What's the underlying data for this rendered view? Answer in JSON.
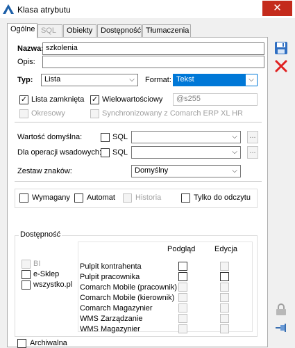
{
  "window": {
    "title": "Klasa atrybutu",
    "close_glyph": "✕"
  },
  "tabs": [
    {
      "label": "Ogólne",
      "state": "active"
    },
    {
      "label": "SQL",
      "state": "disabled"
    },
    {
      "label": "Obiekty",
      "state": "normal"
    },
    {
      "label": "Dostępność",
      "state": "normal"
    },
    {
      "label": "Tłumaczenia",
      "state": "normal"
    }
  ],
  "form": {
    "nazwa_label": "Nazwa:",
    "nazwa_value": "szkolenia",
    "opis_label": "Opis:",
    "opis_value": "",
    "typ_label": "Typ:",
    "typ_value": "Lista",
    "format_label": "Format:",
    "format_value": "Tekst",
    "lista_zamknieta_label": "Lista zamknięta",
    "lista_zamknieta_checked": true,
    "wielowartosciowy_label": "Wielowartościowy",
    "wielowartosciowy_checked": true,
    "code_value": "@s255",
    "okresowy_label": "Okresowy",
    "synchronizowany_label": "Synchronizowany z Comarch ERP XL HR",
    "wartosc_label": "Wartość domyślna:",
    "sql1_label": "SQL",
    "dla_operacji_label": "Dla operacji wsadowych:",
    "sql2_label": "SQL",
    "zestaw_label": "Zestaw znaków:",
    "zestaw_value": "Domyślny",
    "dots_glyph": "..."
  },
  "flags": {
    "wymagany_label": "Wymagany",
    "automat_label": "Automat",
    "historia_label": "Historia",
    "tylko_label": "Tylko do odczytu"
  },
  "dostepnosc": {
    "title": "Dostępność",
    "sites": [
      {
        "label": "BI",
        "disabled": true
      },
      {
        "label": "e-Sklep",
        "disabled": false
      },
      {
        "label": "wszystko.pl",
        "disabled": false
      }
    ],
    "col_podglad": "Podgląd",
    "col_edycja": "Edycja",
    "rows": [
      {
        "label": "Pulpit kontrahenta",
        "podglad_enabled": true,
        "edycja_enabled": false
      },
      {
        "label": "Pulpit pracownika",
        "podglad_enabled": true,
        "edycja_enabled": true
      },
      {
        "label": "Comarch Mobile (pracownik)",
        "podglad_enabled": false,
        "edycja_enabled": false
      },
      {
        "label": "Comarch Mobile (kierownik)",
        "podglad_enabled": false,
        "edycja_enabled": false
      },
      {
        "label": "Comarch Magazynier",
        "podglad_enabled": false,
        "edycja_enabled": false
      },
      {
        "label": "WMS Zarządzanie",
        "podglad_enabled": false,
        "edycja_enabled": false
      },
      {
        "label": "WMS Magazynier",
        "podglad_enabled": false,
        "edycja_enabled": false
      }
    ]
  },
  "archiwalna_label": "Archiwalna",
  "side_icons": [
    "save-icon",
    "delete-icon",
    "lock-icon",
    "pin-icon"
  ],
  "colors": {
    "accent": "#0078d7",
    "close": "#c42b1c",
    "delete": "#e02020"
  }
}
